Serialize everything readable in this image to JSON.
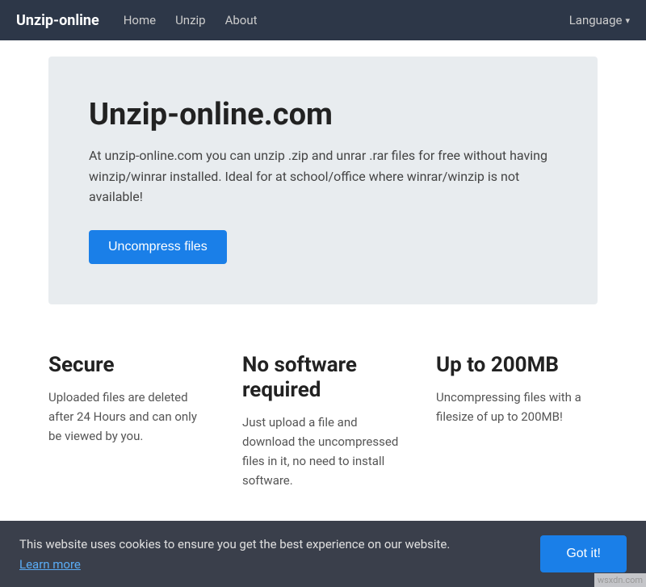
{
  "navbar": {
    "brand": "Unzip-online",
    "links": [
      {
        "label": "Home",
        "id": "home"
      },
      {
        "label": "Unzip",
        "id": "unzip"
      },
      {
        "label": "About",
        "id": "about"
      }
    ],
    "language_label": "Language",
    "dropdown_arrow": "▾"
  },
  "hero": {
    "title": "Unzip-online.com",
    "description": "At unzip-online.com you can unzip .zip and unrar .rar files for free without having winzip/winrar installed. Ideal for at school/office where winrar/winzip is not available!",
    "button_label": "Uncompress files"
  },
  "features": [
    {
      "id": "secure",
      "title": "Secure",
      "description": "Uploaded files are deleted after 24 Hours and can only be viewed by you."
    },
    {
      "id": "no-software",
      "title": "No software required",
      "description": "Just upload a file and download the uncompressed files in it, no need to install software."
    },
    {
      "id": "file-size",
      "title": "Up to 200MB",
      "description": "Uncompressing files with a filesize of up to 200MB!"
    }
  ],
  "cookie_banner": {
    "message": "This website uses cookies to ensure you get the best experience on our website.",
    "learn_more": "Learn more",
    "got_it": "Got it!"
  },
  "watermark": "wsxdn.com"
}
